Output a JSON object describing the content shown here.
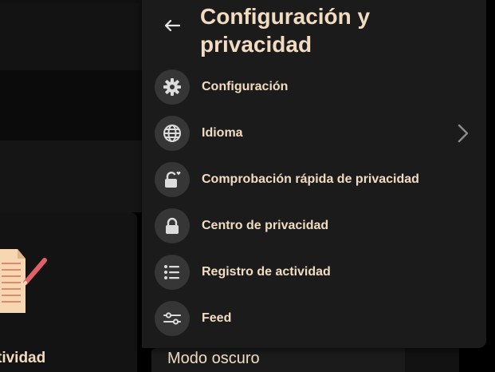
{
  "panel": {
    "title": "Configuración y privacidad",
    "back_icon": "arrow-left-icon",
    "items": [
      {
        "label": "Configuración",
        "icon": "gear-icon"
      },
      {
        "label": "Idioma",
        "icon": "globe-icon",
        "has_submenu": true
      },
      {
        "label": "Comprobación rápida de privacidad",
        "icon": "lock-heart-icon"
      },
      {
        "label": "Centro de privacidad",
        "icon": "lock-icon"
      },
      {
        "label": "Registro de actividad",
        "icon": "list-icon"
      },
      {
        "label": "Feed",
        "icon": "sliders-icon"
      }
    ]
  },
  "background": {
    "activity_label": "tividad",
    "dark_mode_label": "Modo oscuro"
  },
  "colors": {
    "panel_bg": "#1b1b1b",
    "icon_circle": "#363636",
    "text": "#f1dcc2",
    "icon": "#dcdcdc"
  }
}
